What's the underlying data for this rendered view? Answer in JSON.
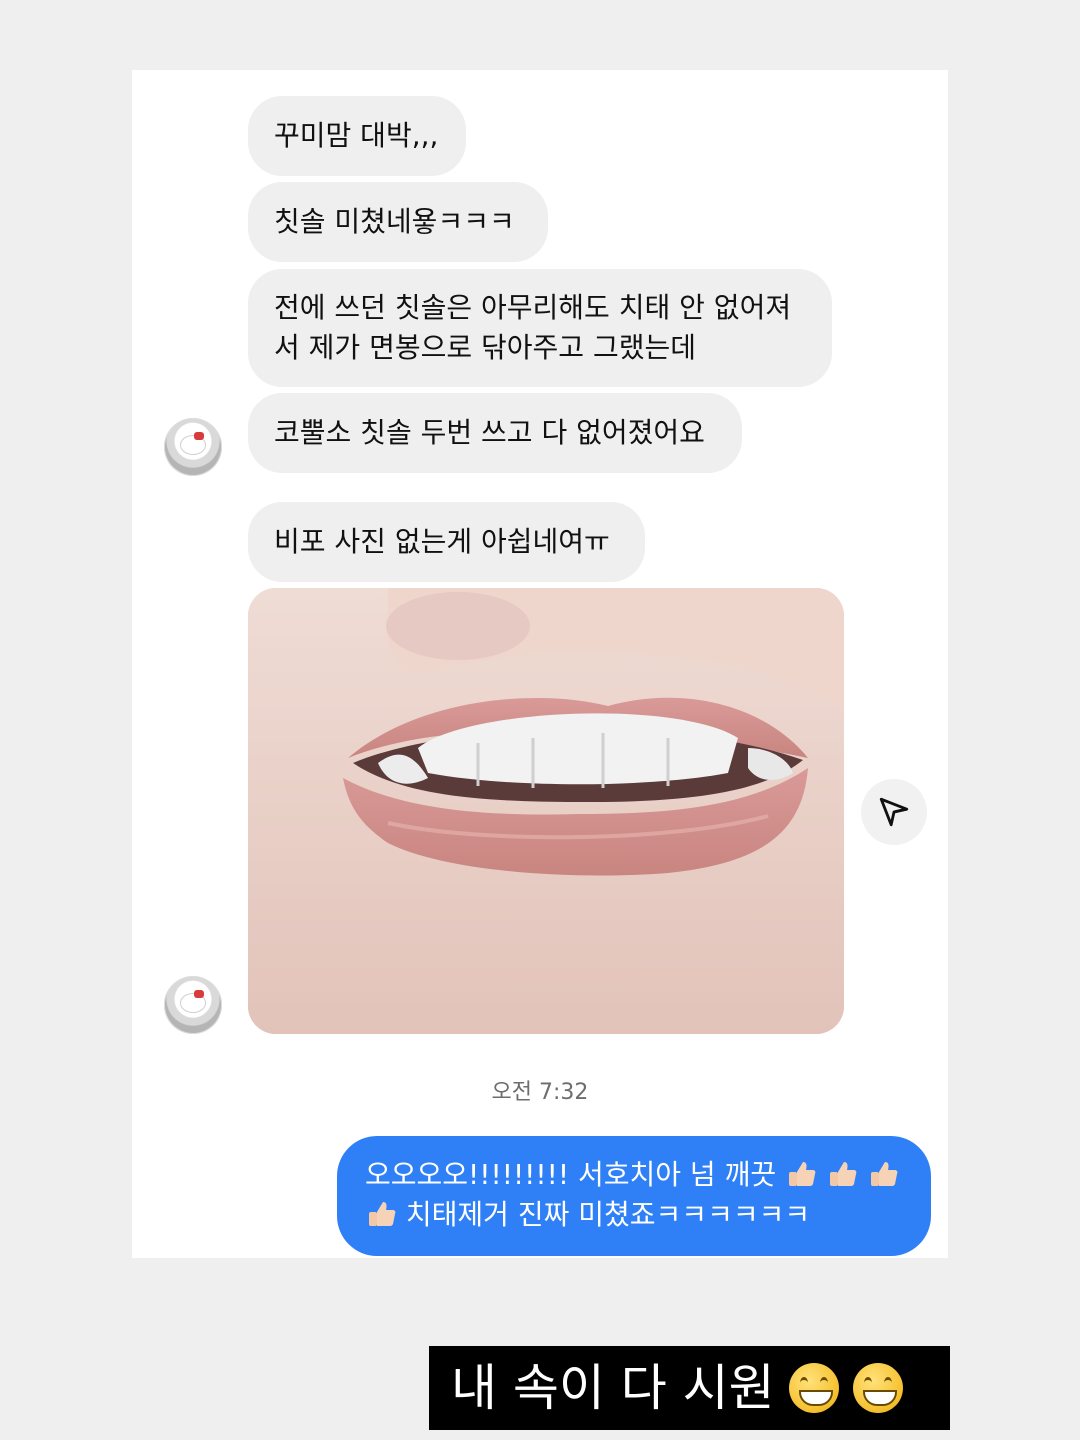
{
  "messages": {
    "received": [
      "꾸미맘 대박,,,",
      "칫솔 미쳤네욯ㅋㅋㅋ",
      "전에 쓰던 칫솔은 아무리해도 치태 안 없어져서 제가 면봉으로 닦아주고 그랬는데",
      "코뿔소 칫솔 두번 쓰고 다 없어졌어요",
      "비포 사진 없는게 아쉽네여ㅠ"
    ],
    "timestamp": "오전 7:32",
    "sent": {
      "line1": "오오오오!!!!!!!!! 서호치아 넘 깨끗",
      "line2": "치태제거 진짜 미쳤죠ㅋㅋㅋㅋㅋㅋ"
    }
  },
  "caption": {
    "text": "내 속이 다 시원"
  },
  "icons": {
    "share": "send-paper-plane-icon",
    "avatar": "hello-kitty-avatar",
    "thumbs": "thumbs-up-icon",
    "grin": "grinning-face-icon"
  },
  "colors": {
    "sent_bubble": "#2f80f6",
    "received_bubble": "#efefef"
  }
}
